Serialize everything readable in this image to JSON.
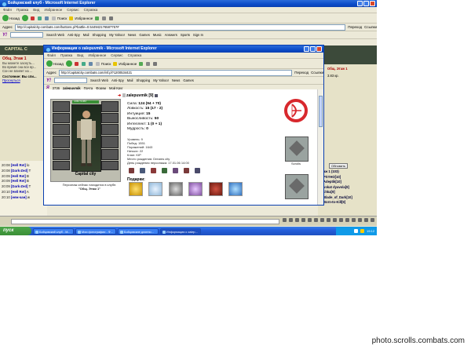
{
  "outer": {
    "title": "Бойцовский клуб - Microsoft Internet Explorer",
    "menu": [
      "Файл",
      "Правка",
      "Вид",
      "Избранное",
      "Сервис",
      "Справка"
    ],
    "toolbar": {
      "back": "Назад",
      "search": "Поиск",
      "favorites": "Избранное"
    },
    "address": "http://capitalcity.combats.com/buttons.pl?battle=0.544942176587757#",
    "go": "Переход",
    "links": "Ссылки",
    "yahoo_links": [
      "Search Web",
      "Anti-Spy",
      "Mail",
      "Shopping",
      "My Yahoo!",
      "News",
      "Games",
      "Music",
      "Answers",
      "Sports",
      "Sign In"
    ]
  },
  "game": {
    "header": "CAPITAL C",
    "room": "Общ. Этаж 1",
    "left_text": [
      "Вы можете заснуть...",
      "Во время сна все вр...",
      "Сон не влияет на ..."
    ],
    "status_label": "Состояние:",
    "status_value": "Вы спи...",
    "wake": "Проснуться",
    "right_room": "Общ. Этаж 1",
    "right_value": "3.83 кр.",
    "refresh": "Обновить",
    "online": [
      "аж 1 (103)",
      "PSYHO[10]",
      "Adeptik[10]",
      "vokat dyavola[9]",
      "chka[9]",
      "Blade_of_Dark[10]",
      "Born-to-Kill[9]"
    ]
  },
  "chat": [
    {
      "time": "20:08",
      "name": "[Hell Ret]",
      "text": "lo"
    },
    {
      "time": "20:08",
      "name": "[Dark-Zed]",
      "text": "T"
    },
    {
      "time": "20:09",
      "name": "[Hell Ret]",
      "text": "B"
    },
    {
      "time": "20:09",
      "name": "[Hell Ret]",
      "text": "B"
    },
    {
      "time": "20:09",
      "name": "[Dark-Zed]",
      "text": "T"
    },
    {
      "time": "20:10",
      "name": "[Hell Ret]",
      "text": "A"
    },
    {
      "time": "20:10",
      "name": "[неж-чан]",
      "text": "w"
    }
  ],
  "inner": {
    "title": "Информация о zalepuvmik - Microsoft Internet Explorer",
    "menu": [
      "Файл",
      "Правка",
      "Вид",
      "Избранное",
      "Сервис",
      "Справка"
    ],
    "address": "http://capitalcity.combats.com/inf.pl?1200534421",
    "go": "Переход",
    "links": "Ссылки",
    "yahoo_links": [
      "Search Web",
      "Anti-Spy",
      "Mail",
      "Shopping",
      "My Yahoo!",
      "News",
      "Games"
    ],
    "links2": [
      "3736",
      "zalepuvmik",
      "Почта",
      "Форум",
      "Мой Круг"
    ],
    "character": {
      "name": "zalepuvmik [9]",
      "hp": "1087/1087",
      "city": "Capital city",
      "location_note": "Персонаж сейчас находится в клубе.",
      "room": "\"Общ. Этаж 1\""
    },
    "stats": [
      {
        "label": "Сила:",
        "value": "124 (94 + 70)"
      },
      {
        "label": "Ловкость:",
        "value": "15 (17 - 2)"
      },
      {
        "label": "Интуиция:",
        "value": "15"
      },
      {
        "label": "Выносливость:",
        "value": "50"
      },
      {
        "label": "Интеллект:",
        "value": "1 (0 + 1)"
      },
      {
        "label": "Мудрость:",
        "value": "0"
      }
    ],
    "info": [
      "Уровень: 9",
      "Побед: 1551",
      "Поражений: 1643",
      "Ничьих: 22",
      "Клан: KIP",
      "Место рождения: Dreams city",
      "День рождения персонажа: 17.01.06 14:00"
    ],
    "gifts_label": "Подарки:",
    "scroll_label": "Scrolls"
  },
  "taskbar": {
    "start": "пуск",
    "tasks": [
      "Бойцовский клуб - M...",
      "Мои фотографии - Ф...",
      "Бойцовские длинно...",
      "Информация о zalep..."
    ],
    "clock": "19:12"
  },
  "watermark": "photo.scrolls.combats.com",
  "colors": {
    "xp_blue": "#245edb",
    "title_blue": "#0a4bc8",
    "green_start": "#3a8f36",
    "hp_bar": "#3a8f36",
    "clan_red": "#d8282d"
  }
}
